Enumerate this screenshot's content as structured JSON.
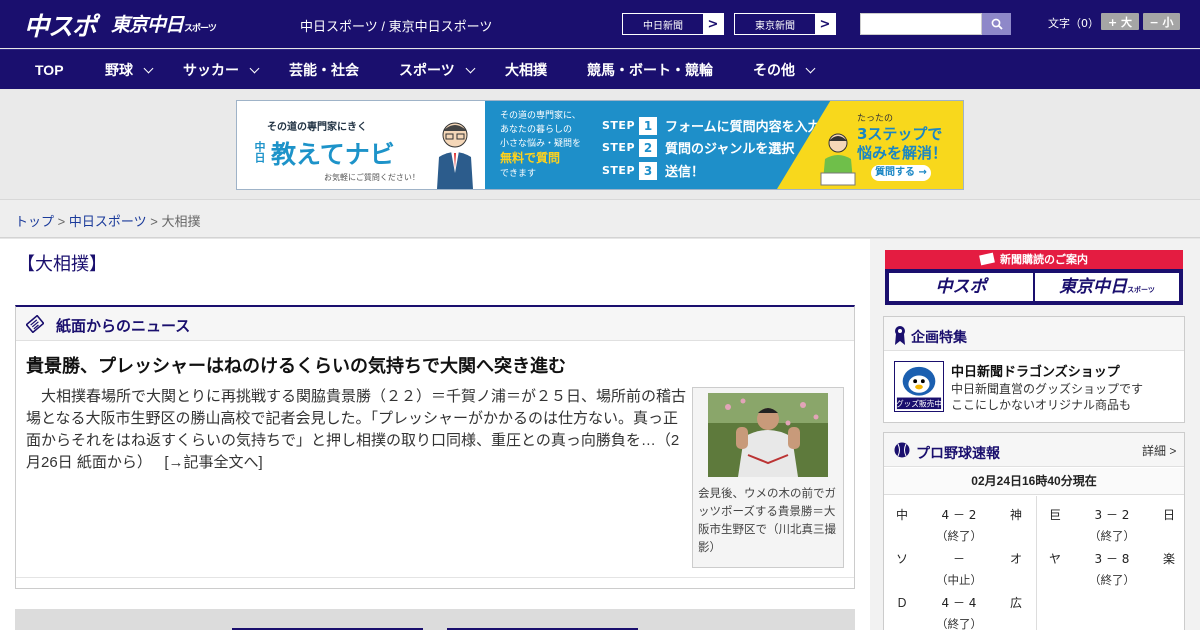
{
  "header": {
    "logo_chuspo": "中スポ",
    "logo_tokyo": "東京中日",
    "logo_tokyo_small": "スポーツ",
    "site_title": "中日スポーツ / 東京中日スポーツ",
    "link_chunichi": "中日新聞",
    "link_tokyo": "東京新聞",
    "arrow": ">",
    "font_size_label": "文字（0）",
    "font_big": "+ 大",
    "font_small": "− 小"
  },
  "nav": {
    "items": [
      {
        "label": "TOP",
        "dropdown": false
      },
      {
        "label": "野球",
        "dropdown": true
      },
      {
        "label": "サッカー",
        "dropdown": true
      },
      {
        "label": "芸能・社会",
        "dropdown": false
      },
      {
        "label": "スポーツ",
        "dropdown": true
      },
      {
        "label": "大相撲",
        "dropdown": false
      },
      {
        "label": "競馬・ボート・競輪",
        "dropdown": false
      },
      {
        "label": "その他",
        "dropdown": true
      }
    ]
  },
  "banner": {
    "tagline": "その道の専門家にきく",
    "brand_prefix": "中日",
    "brand": "教えてナビ",
    "sub": "お気軽にご質問ください！",
    "mid_lines": [
      "その道の専門家に、",
      "あなたの暮らしの",
      "小さな悩み・疑問を"
    ],
    "mid_emph": "無料で質問",
    "mid_last": "できます",
    "steps": [
      {
        "label": "STEP",
        "num": "1",
        "text": "フォームに質問内容を入力"
      },
      {
        "label": "STEP",
        "num": "2",
        "text": "質問のジャンルを選択"
      },
      {
        "label": "STEP",
        "num": "3",
        "text": "送信！"
      }
    ],
    "right_top": "たったの",
    "right_big": "3ステップで",
    "right_big2": "悩みを解消！",
    "right_btn": "質問する →"
  },
  "breadcrumb": {
    "top": "トップ",
    "sep": ">",
    "middle": "中日スポーツ",
    "current": "大相撲"
  },
  "main": {
    "category_title": "【大相撲】",
    "news_section_title": "紙面からのニュース",
    "article": {
      "title": "貴景勝、プレッシャーはねのけるくらいの気持ちで大関へ突き進む",
      "body": "大相撲春場所で大関とりに再挑戦する関脇貴景勝（２２）＝千賀ノ浦＝が２５日、場所前の稽古場となる大阪市生野区の勝山高校で記者会見した。「プレッシャーがかかるのは仕方ない。真っ正面からそれをはね返すくらいの気持ちで」と押し相撲の取り口同様、重圧との真っ向勝負を…（2月26日 紙面から）",
      "more_link": "[→記事全文へ]",
      "photo_caption": "会見後、ウメの木の前でガッツポーズする貴景勝＝大阪市生野区で（川北真三撮影）"
    }
  },
  "sidebar": {
    "subscribe_title": "新聞購読のご案内",
    "subscribe_chuspo": "中スポ",
    "subscribe_tokyo": "東京中日",
    "subscribe_tokyo_small": "スポーツ",
    "feature_title": "企画特集",
    "feature_item": {
      "title": "中日新聞ドラゴンズショップ",
      "desc_line1": "中日新聞直営のグッズショップです",
      "desc_line2": "ここにしかないオリジナル商品も",
      "img_label": "グッズ販売中"
    },
    "pro_title": "プロ野球速報",
    "pro_detail": "詳細 >",
    "pro_time": "02月24日16時40分現在",
    "games": [
      {
        "home": "中",
        "score": "4 － 2",
        "away": "神",
        "status": "（終了）"
      },
      {
        "home": "巨",
        "score": "3 － 2",
        "away": "日",
        "status": "（終了）"
      },
      {
        "home": "ソ",
        "score": "－",
        "away": "オ",
        "status": "（中止）"
      },
      {
        "home": "ヤ",
        "score": "3 － 8",
        "away": "楽",
        "status": "（終了）"
      },
      {
        "home": "Ｄ",
        "score": "4 － 4",
        "away": "広",
        "status": "（終了）"
      }
    ]
  },
  "colors": {
    "brand_navy": "#1a0f6e",
    "accent_red": "#e41c41",
    "banner_blue": "#1e8fc9",
    "banner_yellow": "#f8d81c"
  }
}
